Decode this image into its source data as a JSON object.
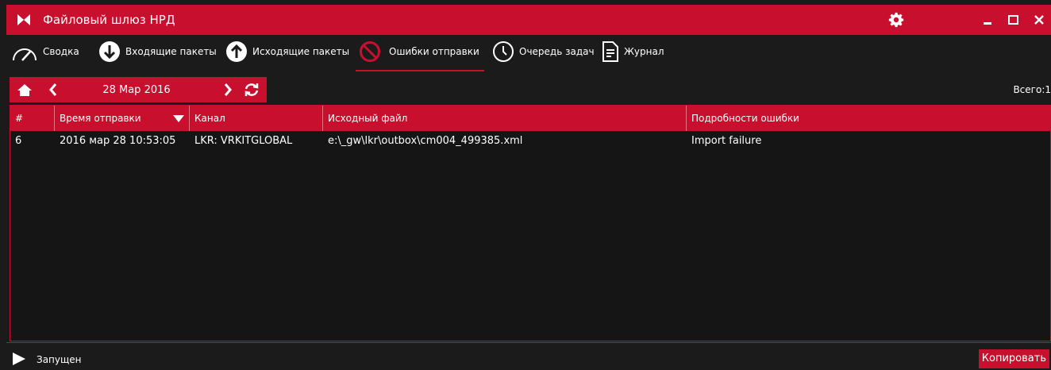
{
  "app": {
    "title": "Файловый шлюз НРД",
    "accent_color": "#c8102e"
  },
  "nav": {
    "items": [
      {
        "label": "Сводка",
        "icon": "gauge-icon"
      },
      {
        "label": "Входящие пакеты",
        "icon": "arrow-down-circle-icon"
      },
      {
        "label": "Исходящие пакеты",
        "icon": "arrow-up-circle-icon"
      },
      {
        "label": "Ошибки отправки",
        "icon": "prohibited-icon",
        "active": true
      },
      {
        "label": "Очередь задач",
        "icon": "clock-icon"
      },
      {
        "label": "Журнал",
        "icon": "document-icon"
      }
    ]
  },
  "datebar": {
    "date": "28 Мар 2016"
  },
  "total": "Всего:1",
  "table": {
    "columns": [
      "#",
      "Время отправки",
      "Канал",
      "Исходный файл",
      "Подробности ошибки"
    ],
    "rows": [
      [
        "6",
        "2016 мар 28 10:53:05",
        "LKR: VRKITGLOBAL",
        "e:\\_gw\\lkr\\outbox\\cm004_499385.xml",
        "Import failure"
      ]
    ]
  },
  "status": {
    "text": "Запущен"
  },
  "copy_button": "Копировать"
}
